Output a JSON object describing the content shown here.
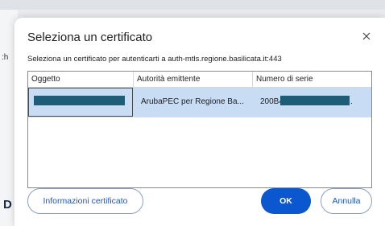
{
  "background": {
    "fragment_left_text": ":h",
    "fragment_bottom_text": "D"
  },
  "dialog": {
    "title": "Seleziona un certificato",
    "close_icon": "close-icon",
    "subtitle": "Seleziona un certificato per autenticarti a auth-mtls.regione.basilicata.it:443",
    "columns": [
      "Oggetto",
      "Autorità emittente",
      "Numero di serie"
    ],
    "rows": [
      {
        "subject": "",
        "issuer": "ArubaPEC per Regione Ba...",
        "serial_prefix": "200B4",
        "serial_suffix": ".",
        "selected": true,
        "redacted": true
      }
    ],
    "buttons": {
      "info": "Informazioni certificato",
      "ok": "OK",
      "cancel": "Annulla"
    },
    "colors": {
      "primary": "#0b57d0",
      "selection": "#c8dcf3",
      "redaction": "#1e5d78"
    }
  }
}
